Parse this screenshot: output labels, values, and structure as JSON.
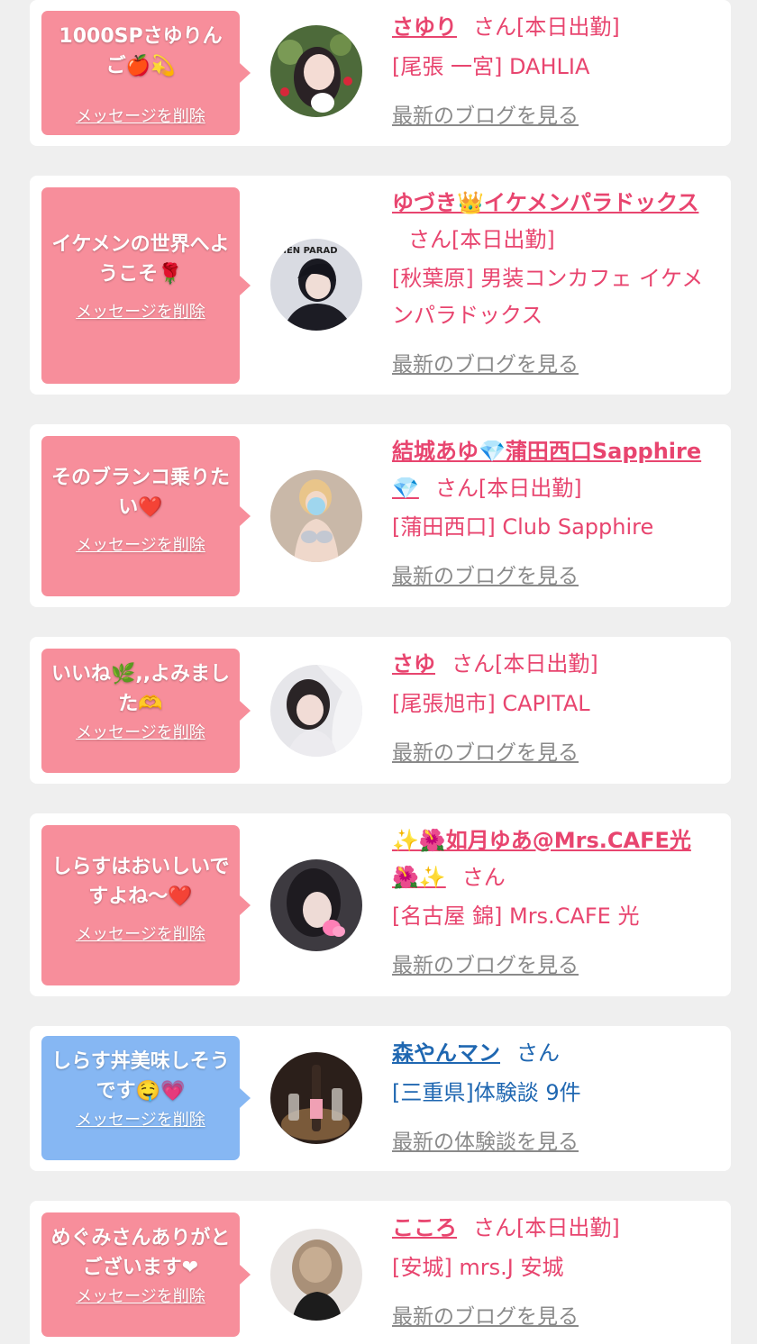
{
  "delete_label": "メッセージを削除",
  "items": [
    {
      "message": "1000SPさゆりんご🍎💫",
      "name": "さゆり",
      "suffix": "さん[本日出勤]",
      "shop": "[尾張 一宮] DAHLIA",
      "link": "最新のブログを見る",
      "theme": "pink"
    },
    {
      "message": "イケメンの世界へようこそ🌹",
      "name": "ゆづき👑イケメンパラドックス",
      "suffix": "さん[本日出勤]",
      "shop": "[秋葉原] 男装コンカフェ イケメンパラドックス",
      "link": "最新のブログを見る",
      "avatar_text": "MEN PARAD",
      "theme": "pink"
    },
    {
      "message": "そのブランコ乗りたい❤️",
      "name": "結城あゆ💎蒲田西口Sapphire💎",
      "suffix": "さん[本日出勤]",
      "shop": "[蒲田西口] Club Sapphire",
      "link": "最新のブログを見る",
      "theme": "pink"
    },
    {
      "message": "いいね🌿,,よみました🫶",
      "name": "さゆ",
      "suffix": "さん[本日出勤]",
      "shop": "[尾張旭市] CAPITAL",
      "link": "最新のブログを見る",
      "theme": "pink"
    },
    {
      "message": "しらすはおいしいですよね〜❤️",
      "name": "✨🌺如月ゆあ@Mrs.CAFE光🌺✨",
      "suffix": "さん",
      "shop": "[名古屋 錦] Mrs.CAFE 光",
      "link": "最新のブログを見る",
      "theme": "pink"
    },
    {
      "message": "しらす丼美味しそうです🤤💗",
      "name": "森やんマン",
      "suffix": "さん",
      "shop": "[三重県]体験談 9件",
      "link": "最新の体験談を見る",
      "theme": "blue"
    },
    {
      "message": "めぐみさんありがとございます❤",
      "name": "こころ",
      "suffix": "さん[本日出勤]",
      "shop": "[安城] mrs.J 安城",
      "link": "最新のブログを見る",
      "theme": "pink"
    }
  ]
}
